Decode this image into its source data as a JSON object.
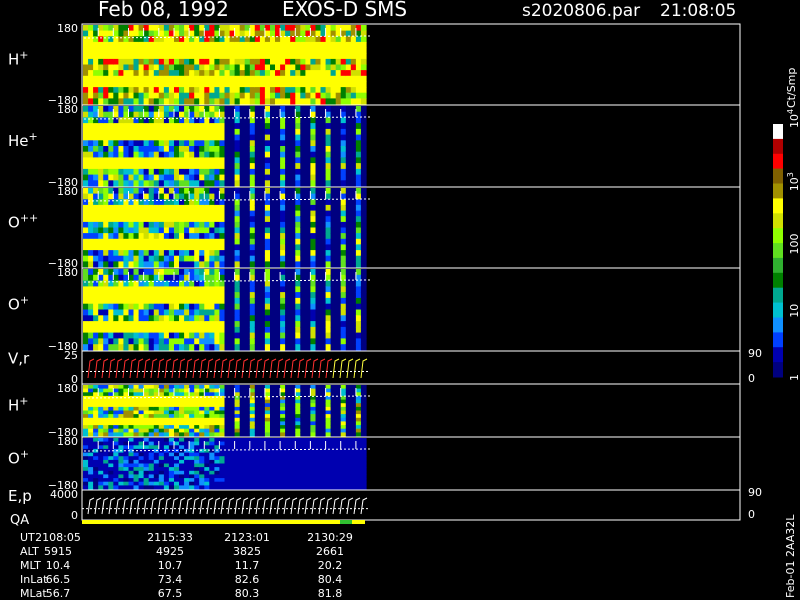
{
  "header": {
    "date": "Feb 08, 1992",
    "instrument": "EXOS-D SMS",
    "file": "s2020806.par",
    "time": "21:08:05"
  },
  "colorbar": {
    "unit": "Ct/Smp",
    "ticks": [
      {
        "label": "1",
        "value": 1
      },
      {
        "label": "10",
        "value": 10
      },
      {
        "label": "100",
        "value": 100
      },
      {
        "label": "10",
        "sup": "3",
        "value": 1000
      },
      {
        "label": "10",
        "sup": "4",
        "value": 10000
      }
    ],
    "colors": [
      "#000080",
      "#0000b0",
      "#0040ff",
      "#1090ff",
      "#00c0d0",
      "#00a890",
      "#008000",
      "#30b030",
      "#60e020",
      "#90ff00",
      "#d0e000",
      "#ffff00",
      "#a09000",
      "#806000",
      "#ff0000",
      "#b00000",
      "#ffffff"
    ]
  },
  "panels": [
    {
      "id": "h-plus-1",
      "label": "H",
      "sup": "+",
      "ytop": "180",
      "ybot": "−180",
      "kind": "spec",
      "palette": "hi"
    },
    {
      "id": "he-plus",
      "label": "He",
      "sup": "+",
      "ytop": "180",
      "ybot": "−180",
      "kind": "spec",
      "palette": "mid"
    },
    {
      "id": "o-plus-plus",
      "label": "O",
      "sup": "++",
      "ytop": "180",
      "ybot": "−180",
      "kind": "spec",
      "palette": "mid"
    },
    {
      "id": "o-plus-1",
      "label": "O",
      "sup": "+",
      "ytop": "180",
      "ybot": "−180",
      "kind": "spec",
      "palette": "mid"
    },
    {
      "id": "vr",
      "label": "V,r",
      "ytop": "25",
      "ybot": "0",
      "rtop": "90",
      "rbot": "0",
      "kind": "line"
    },
    {
      "id": "h-plus-2",
      "label": "H",
      "sup": "+",
      "ytop": "180",
      "ybot": "−180",
      "kind": "spec",
      "palette": "hi2"
    },
    {
      "id": "o-plus-2",
      "label": "O",
      "sup": "+",
      "ytop": "180",
      "ybot": "−180",
      "kind": "spec",
      "palette": "lo"
    },
    {
      "id": "ep",
      "label": "E,p",
      "ytop": "4000",
      "ybot": "0",
      "rtop": "90",
      "rbot": "0",
      "kind": "line"
    }
  ],
  "qa_label": "QA",
  "ephemeris": {
    "rows": [
      {
        "name": "UT",
        "values": [
          "2108:05",
          "2115:33",
          "2123:01",
          "2130:29"
        ]
      },
      {
        "name": "ALT",
        "values": [
          "5915",
          "4925",
          "3825",
          "2661"
        ]
      },
      {
        "name": "MLT",
        "values": [
          "10.4",
          "10.7",
          "11.7",
          "20.2"
        ]
      },
      {
        "name": "InLat",
        "values": [
          "66.5",
          "73.4",
          "82.6",
          "80.4"
        ]
      },
      {
        "name": "MLat",
        "values": [
          "56.7",
          "67.5",
          "80.3",
          "81.8"
        ]
      }
    ]
  },
  "footer_id": "Feb-01 2AA32L"
}
